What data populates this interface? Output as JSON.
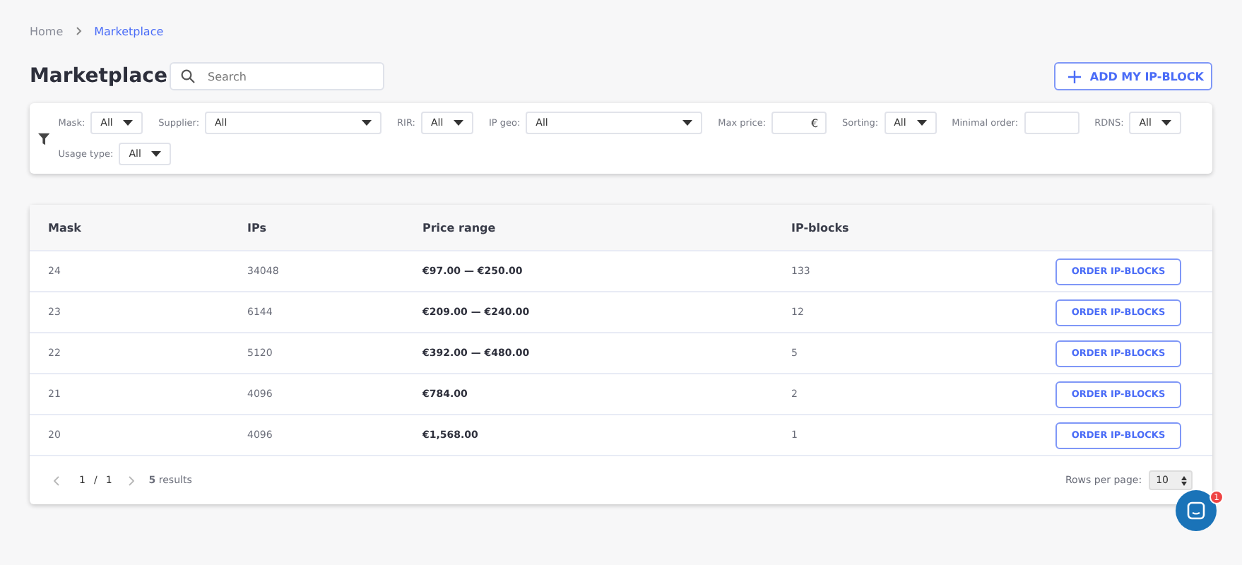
{
  "breadcrumb": [
    {
      "label": "Home",
      "current": false
    },
    {
      "label": "Marketplace",
      "current": true
    }
  ],
  "title": "Marketplace",
  "search": {
    "placeholder": "Search"
  },
  "add_button": {
    "label": "ADD MY IP-BLOCK"
  },
  "filters": [
    {
      "kind": "select",
      "label": "Mask:",
      "value": "All"
    },
    {
      "kind": "wideselect",
      "label": "Supplier:",
      "value": "All"
    },
    {
      "kind": "select",
      "label": "RIR:",
      "value": "All"
    },
    {
      "kind": "wideselect",
      "label": "IP geo:",
      "value": "All"
    },
    {
      "kind": "input",
      "label": "Max price:",
      "suffix": "€"
    },
    {
      "kind": "select",
      "label": "Sorting:",
      "value": "All"
    },
    {
      "kind": "input",
      "label": "Minimal order:"
    },
    {
      "kind": "select",
      "label": "RDNS:",
      "value": "All"
    },
    {
      "kind": "select",
      "label": "Usage type:",
      "value": "All"
    }
  ],
  "table": {
    "columns": [
      "Mask",
      "IPs",
      "Price range",
      "IP-blocks"
    ],
    "rows": [
      {
        "mask": "24",
        "ips": "34048",
        "price": "€97.00 — €250.00",
        "blocks": "133",
        "action": "ORDER IP-BLOCKS"
      },
      {
        "mask": "23",
        "ips": "6144",
        "price": "€209.00 — €240.00",
        "blocks": "12",
        "action": "ORDER IP-BLOCKS"
      },
      {
        "mask": "22",
        "ips": "5120",
        "price": "€392.00 — €480.00",
        "blocks": "5",
        "action": "ORDER IP-BLOCKS"
      },
      {
        "mask": "21",
        "ips": "4096",
        "price": "€784.00",
        "blocks": "2",
        "action": "ORDER IP-BLOCKS"
      },
      {
        "mask": "20",
        "ips": "4096",
        "price": "€1,568.00",
        "blocks": "1",
        "action": "ORDER IP-BLOCKS"
      }
    ]
  },
  "pagination": {
    "page": "1",
    "separator": "/",
    "total": "1",
    "results": "**5** results",
    "rows_label": "Rows per page:",
    "rows_value": "10"
  },
  "chat": {
    "badge": "1"
  }
}
